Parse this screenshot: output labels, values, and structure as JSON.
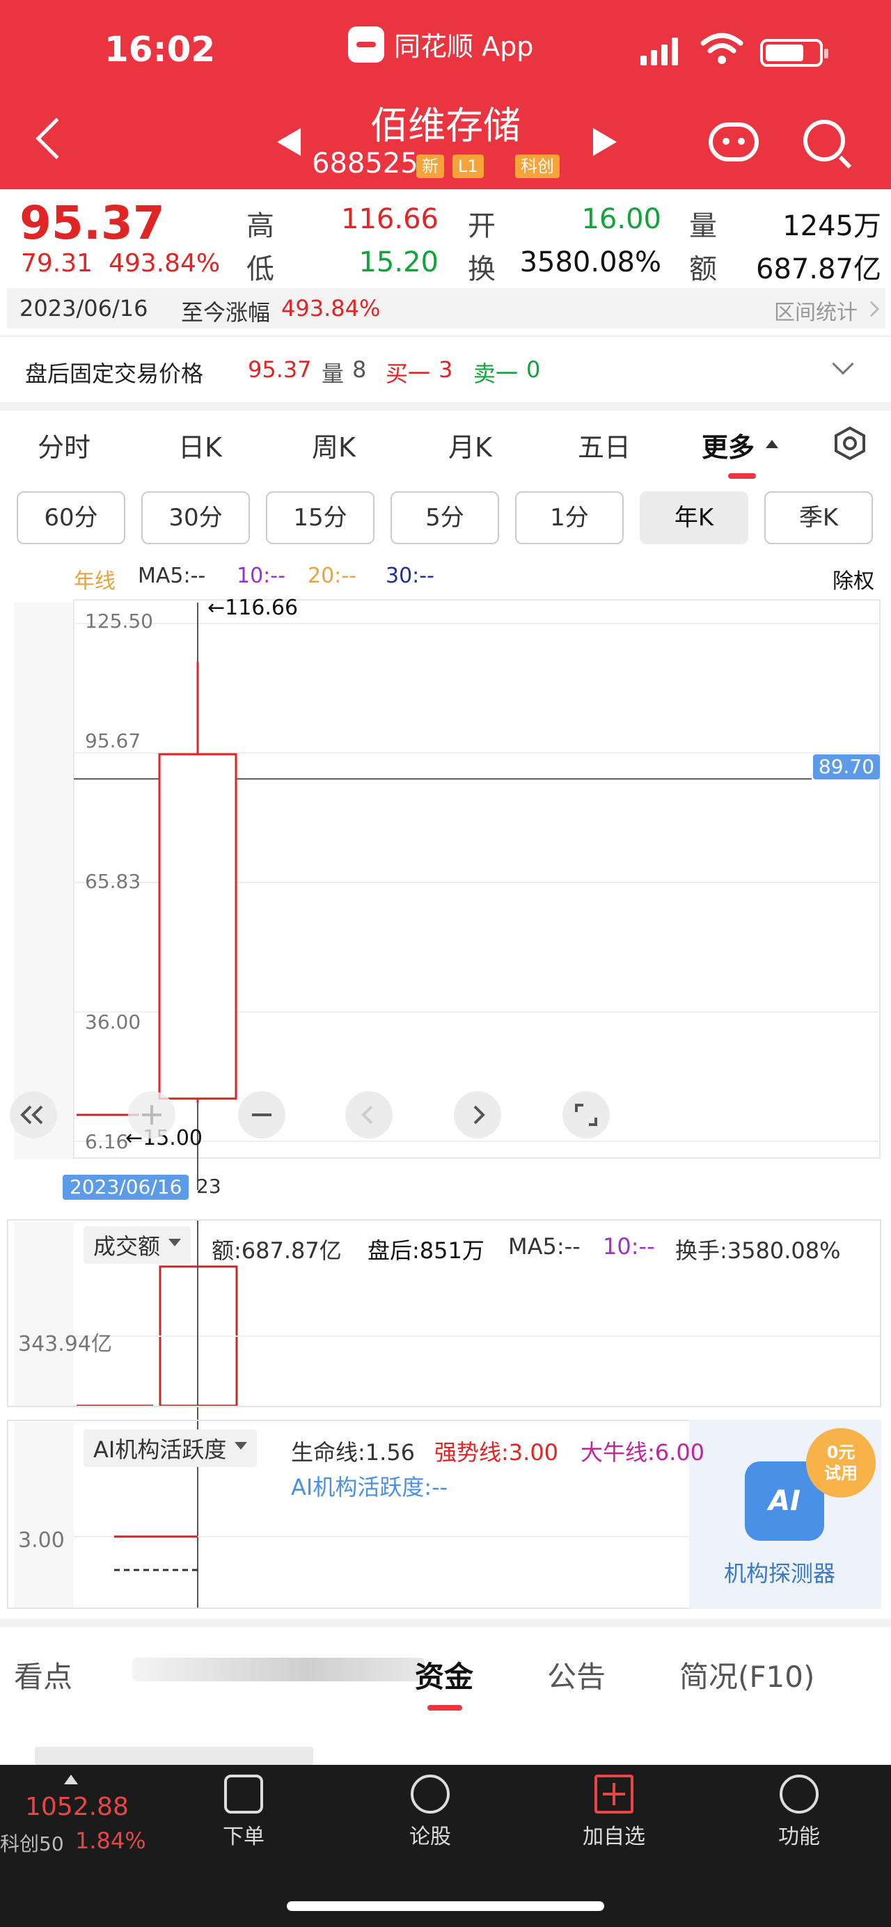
{
  "status_bar": {
    "time": "16:02",
    "app_name": "同花顺 App"
  },
  "header": {
    "title": "佰维存储",
    "code": "688525",
    "tags": [
      "新",
      "L1",
      "科创"
    ]
  },
  "quote": {
    "price": "95.37",
    "change_abs": "79.31",
    "change_pct": "493.84%",
    "high_label": "高",
    "high": "116.66",
    "low_label": "低",
    "low": "15.20",
    "open_label": "开",
    "open": "16.00",
    "turnover_label": "换",
    "turnover": "3580.08%",
    "volume_label": "量",
    "volume": "1245万",
    "amount_label": "额",
    "amount": "687.87亿"
  },
  "range_row": {
    "date": "2023/06/16",
    "label": "至今涨幅",
    "value": "493.84%",
    "stats": "区间统计"
  },
  "after_hours": {
    "label": "盘后固定交易价格",
    "price": "95.37",
    "vol_label": "量",
    "vol": "8",
    "buy_label": "买一",
    "buy": "3",
    "sell_label": "卖一",
    "sell": "0"
  },
  "period_tabs": [
    "分时",
    "日K",
    "周K",
    "月K",
    "五日",
    "更多"
  ],
  "sub_tabs": [
    "60分",
    "30分",
    "15分",
    "5分",
    "1分",
    "年K",
    "季K"
  ],
  "ma_legend": {
    "kind": "年线",
    "ma5": "MA5:--",
    "ma10": "10:--",
    "ma20": "20:--",
    "ma30": "30:--",
    "adjust": "除权"
  },
  "chart_data": {
    "type": "candlestick",
    "period": "年K",
    "y_ticks": [
      "125.50",
      "95.67",
      "65.83",
      "36.00",
      "6.16"
    ],
    "ylim": [
      6.16,
      125.5
    ],
    "candles": [
      {
        "date": "2023/06/16",
        "open": 16.0,
        "close": 95.37,
        "high": 116.66,
        "low": 15.0
      }
    ],
    "high_marker": "←116.66",
    "low_marker": "←15.00",
    "crosshair_price": "89.70",
    "crosshair_date": "2023/06/16",
    "date_tail": "23"
  },
  "volume_panel": {
    "selector": "成交额",
    "amount": "额:687.87亿",
    "after_hours": "盘后:851万",
    "ma5": "MA5:--",
    "ma10": "10:--",
    "turnover": "换手:3580.08%",
    "axis_label": "343.94亿"
  },
  "ai_panel": {
    "selector": "AI机构活跃度",
    "life_line": "生命线:1.56",
    "strong_line": "强势线:3.00",
    "bull_line": "大牛线:6.00",
    "activity": "AI机构活跃度:--",
    "axis_label": "3.00",
    "badge_line1": "0元",
    "badge_line2": "试用",
    "detector_icon": "AI",
    "detector_label": "机构探测器"
  },
  "content_tabs": [
    "看点",
    "资金",
    "公告",
    "简况(F10)"
  ],
  "bottom_bar": {
    "index_value": "1052.88",
    "index_name": "科创50",
    "index_pct": "1.84%",
    "items": [
      "下单",
      "论股",
      "加自选",
      "功能"
    ]
  },
  "colors": {
    "up": "#e02525",
    "down": "#12a33a",
    "brand": "#ea3540",
    "crosshair": "#5b9be8"
  }
}
